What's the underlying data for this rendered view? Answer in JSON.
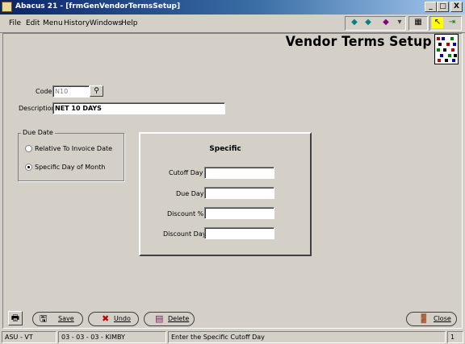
{
  "window": {
    "title": "Abacus 21 - [frmGenVendorTermsSetup]",
    "controls": {
      "minimize": "_",
      "restore": "□",
      "close": "X"
    }
  },
  "menu": [
    "File",
    "Edit",
    "Menu",
    "History",
    "Windows",
    "Help"
  ],
  "toolbar": {
    "icons": [
      "back-arrow-icon",
      "forward-arrow-icon",
      "bookmark-icon",
      "calculator-icon",
      "help-pointer-icon",
      "exit-icon"
    ]
  },
  "header": {
    "title": "Vendor Terms Setup"
  },
  "form": {
    "code_label": "Code",
    "code_value": "N10",
    "description_label": "Description",
    "description_value": "NET 10 DAYS"
  },
  "due_date": {
    "group_label": "Due Date",
    "options": [
      {
        "label": "Relative To Invoice Date",
        "selected": false
      },
      {
        "label": "Specific Day of Month",
        "selected": true
      }
    ]
  },
  "specific": {
    "title": "Specific",
    "fields": [
      {
        "label": "Cutoff Day",
        "value": ""
      },
      {
        "label": "Due Day",
        "value": ""
      },
      {
        "label": "Discount %",
        "value": ""
      },
      {
        "label": "Discount Day",
        "value": ""
      }
    ]
  },
  "buttons": {
    "save_label": "Save",
    "undo_label": "Undo",
    "delete_label": "Delete",
    "close_label": "Close"
  },
  "status": {
    "company": "ASU - VT",
    "user": "03 - 03 - 03 - KIMBY",
    "message": "Enter the Specific Cutoff Day",
    "page": "1"
  },
  "colors": {
    "title_bar": "#0a246a",
    "face": "#d4d0c8",
    "delete_icon": "#7a2060"
  }
}
